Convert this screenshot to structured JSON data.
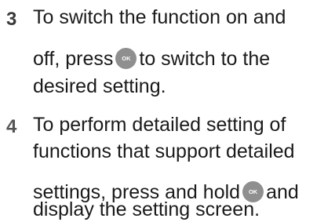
{
  "steps": [
    {
      "number": "3",
      "lines": {
        "line1": "To switch the function on and",
        "line2_before": "off, press",
        "line2_after": "to switch to the",
        "line3": "desired setting."
      }
    },
    {
      "number": "4",
      "lines": {
        "line1": "To perform detailed setting of",
        "line2": "functions that support detailed",
        "line3_before": "settings, press and hold",
        "line3_after": "and",
        "line4": "display the setting screen."
      }
    }
  ],
  "ok_button": {
    "label": "OK",
    "icon": "ok-button-icon",
    "color": "#8f8f8f"
  }
}
